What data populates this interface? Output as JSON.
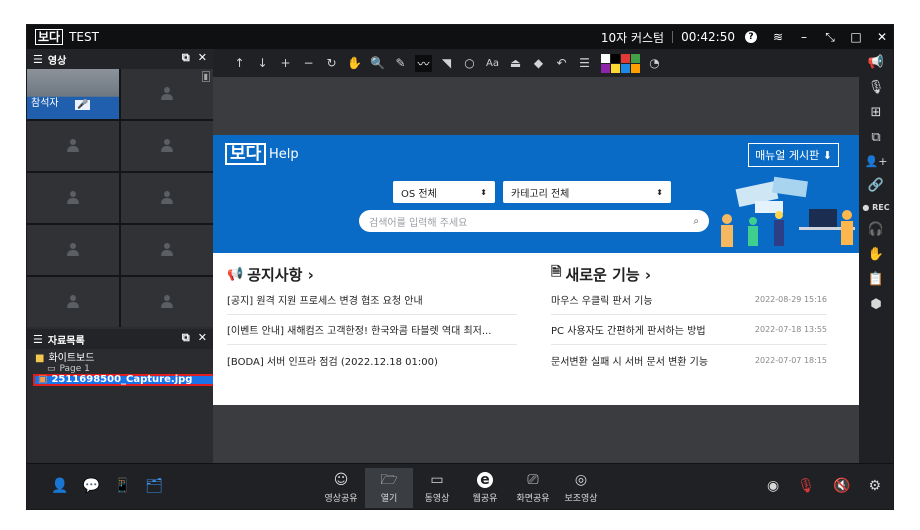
{
  "titlebar": {
    "logo": "보다",
    "title": "TEST",
    "layout": "10자 커스텀",
    "timer": "00:42:50",
    "help_icon": "?",
    "wifi_icon": "≋",
    "minimize": "–",
    "restore": "⤡",
    "maximize": "□",
    "close": "✕"
  },
  "video_panel": {
    "title": "영상",
    "popout_icon": "⧉",
    "close_icon": "✕",
    "active_label": "참석자",
    "mic_icon": "🎤",
    "mute_badge": "▮"
  },
  "resource_panel": {
    "title": "자료목록",
    "popout_icon": "⧉",
    "close_icon": "✕",
    "folder": "화이트보드",
    "page": "Page 1",
    "file": "2511698500_Capture.jpg"
  },
  "toolbar": {
    "tools": [
      "↑",
      "↓",
      "+",
      "−",
      "↻",
      "✋",
      "🔍",
      "✎",
      "〰",
      "◥",
      "○",
      "Aa",
      "⏏",
      "◆",
      "↶",
      "☰"
    ],
    "palette_colors": [
      "#ffffff",
      "#000000",
      "#e53935",
      "#43a047",
      "#8e24aa",
      "#fdd835",
      "#1e88e5",
      "#ffa000"
    ],
    "palette_icon": "◔"
  },
  "web": {
    "logo": "보다",
    "help": "Help",
    "manual_button": "매뉴얼 게시판 ⬇",
    "os_select": "OS 전체",
    "category_select": "카테고리 전체",
    "select_arrow": "⬍",
    "search_placeholder": "검색어를 입력해 주세요",
    "search_icon": "⌕",
    "notice": {
      "title": "공지사항 ›",
      "icon": "📢",
      "items": [
        "[공지] 원격 지원 프로세스 변경 협조 요청 안내",
        "[이벤트 안내] 새해컴즈 고객한정! 한국와콤 타블렛 역대 최저...",
        "[BODA] 서버 인프라 점검 (2022.12.18 01:00)"
      ]
    },
    "features": {
      "title": "새로운 기능 ›",
      "icon": "🗎",
      "items": [
        {
          "text": "마우스 우클릭 판서 기능",
          "date": "2022-08-29 15:16"
        },
        {
          "text": "PC 사용자도 간편하게 판서하는 방법",
          "date": "2022-07-18 13:55"
        },
        {
          "text": "문서변환 실패 시 서버 문서 변환 기능",
          "date": "2022-07-07 18:15"
        }
      ]
    }
  },
  "rightbar": {
    "icons": [
      "📢",
      "🎙",
      "⊞",
      "⧉",
      "👤+",
      "🔗"
    ],
    "rec": "● REC",
    "icons2": [
      "🎧",
      "✋",
      "📋",
      "⬢"
    ]
  },
  "bottombar": {
    "left_icons": [
      "👤",
      "💬",
      "📱",
      "🗂"
    ],
    "buttons": [
      {
        "icon": "☺",
        "label": "영상공유"
      },
      {
        "icon": "🗁",
        "label": "열기"
      },
      {
        "icon": "▭",
        "label": "동영상"
      },
      {
        "icon": "e",
        "label": "웹공유"
      },
      {
        "icon": "⎚",
        "label": "화면공유"
      },
      {
        "icon": "◎",
        "label": "보조영상"
      }
    ],
    "right_icons": [
      "◉",
      "🎙",
      "🔇",
      "⚙"
    ]
  }
}
